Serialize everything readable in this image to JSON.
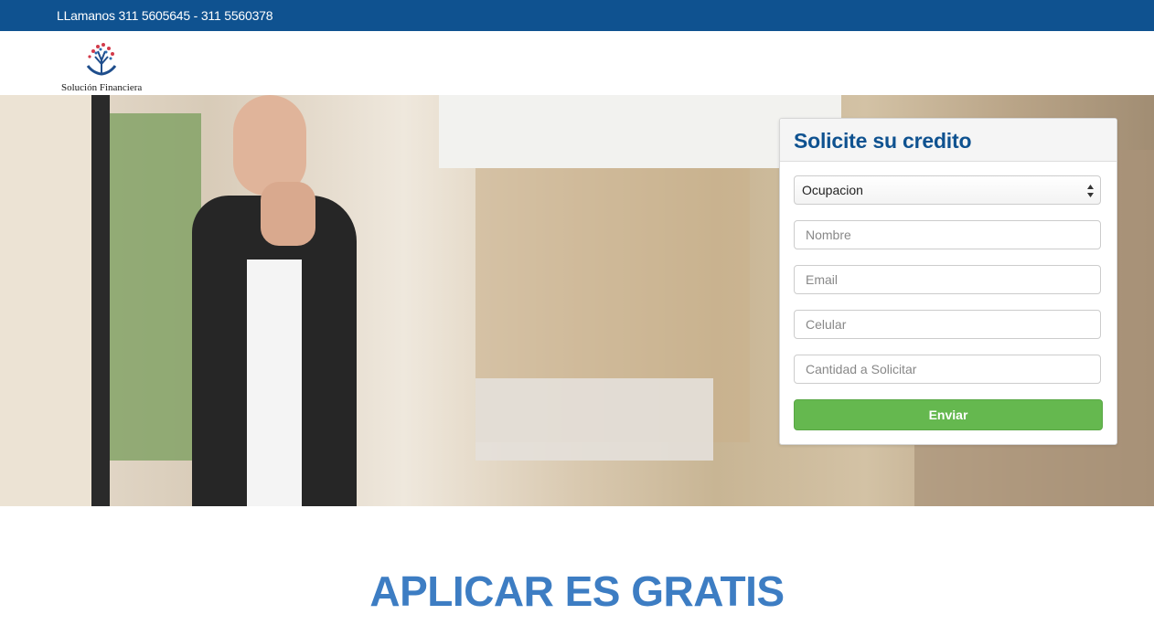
{
  "topbar": {
    "phone_text": "LLamanos 311 5605645 - 311 5560378",
    "background": "#0f5290"
  },
  "logo": {
    "text": "Solución Financiera",
    "icon": "tree-hands-logo"
  },
  "form": {
    "title": "Solicite su credito",
    "occupation_select": {
      "value": "Ocupacion",
      "options": [
        "Ocupacion"
      ]
    },
    "name_placeholder": "Nombre",
    "email_placeholder": "Email",
    "phone_placeholder": "Celular",
    "amount_placeholder": "Cantidad a Solicitar",
    "submit_label": "Enviar",
    "submit_color": "#65b84f"
  },
  "cta": {
    "title": "APLICAR ES GRATIS",
    "color": "#3d7dc3"
  }
}
